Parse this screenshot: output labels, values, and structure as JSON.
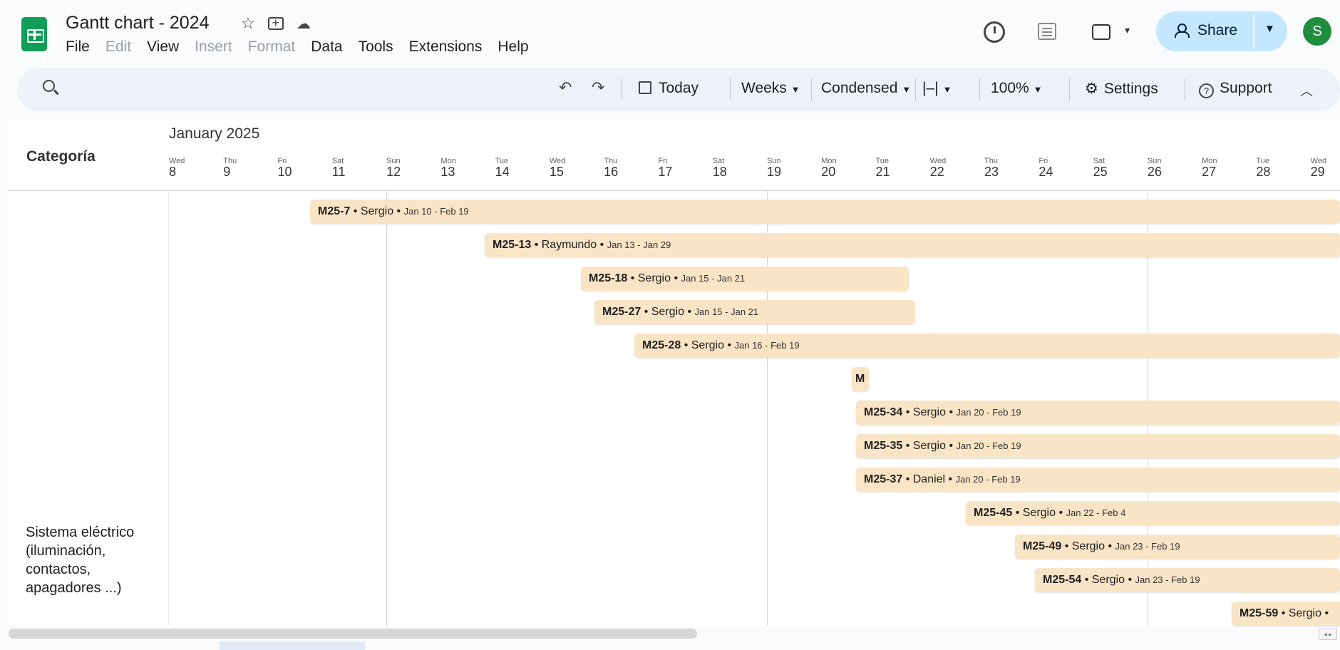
{
  "app": {
    "doc_title": "Gantt chart - 2024",
    "menu": [
      {
        "label": "File",
        "disabled": false
      },
      {
        "label": "Edit",
        "disabled": true
      },
      {
        "label": "View",
        "disabled": false
      },
      {
        "label": "Insert",
        "disabled": true
      },
      {
        "label": "Format",
        "disabled": true
      },
      {
        "label": "Data",
        "disabled": false
      },
      {
        "label": "Tools",
        "disabled": false
      },
      {
        "label": "Extensions",
        "disabled": false
      },
      {
        "label": "Help",
        "disabled": false
      }
    ],
    "share_label": "Share",
    "avatar_initial": "S",
    "accent_color": "#c2e7ff",
    "logo_color": "#0f9d58",
    "avatar_color": "#1e8e3e"
  },
  "toolbar": {
    "today": "Today",
    "weeks": "Weeks",
    "condensed": "Condensed",
    "zoom": "100%",
    "settings": "Settings",
    "support": "Support"
  },
  "timeline": {
    "category_header": "Categoría",
    "month": "January 2025",
    "days": [
      {
        "name": "Wed",
        "date": "8"
      },
      {
        "name": "Thu",
        "date": "9"
      },
      {
        "name": "Fri",
        "date": "10"
      },
      {
        "name": "Sat",
        "date": "11"
      },
      {
        "name": "Sun",
        "date": "12"
      },
      {
        "name": "Mon",
        "date": "13"
      },
      {
        "name": "Tue",
        "date": "14"
      },
      {
        "name": "Wed",
        "date": "15"
      },
      {
        "name": "Thu",
        "date": "16"
      },
      {
        "name": "Fri",
        "date": "17"
      },
      {
        "name": "Sat",
        "date": "18"
      },
      {
        "name": "Sun",
        "date": "19"
      },
      {
        "name": "Mon",
        "date": "20"
      },
      {
        "name": "Tue",
        "date": "21"
      },
      {
        "name": "Wed",
        "date": "22"
      },
      {
        "name": "Thu",
        "date": "23"
      },
      {
        "name": "Fri",
        "date": "24"
      },
      {
        "name": "Sat",
        "date": "25"
      },
      {
        "name": "Sun",
        "date": "26"
      },
      {
        "name": "Mon",
        "date": "27"
      },
      {
        "name": "Tue",
        "date": "28"
      },
      {
        "name": "Wed",
        "date": "29"
      }
    ],
    "category_label": "Sistema eléctrico (iluminación, contactos, apagadores ...)",
    "bar_color": "#fae4c6",
    "tasks": [
      {
        "id": "M25-7",
        "owner": "Sergio",
        "dates": "Jan 10 - Feb 19"
      },
      {
        "id": "M25-13",
        "owner": "Raymundo",
        "dates": "Jan 13 - Jan 29"
      },
      {
        "id": "M25-18",
        "owner": "Sergio",
        "dates": "Jan 15 - Jan 21"
      },
      {
        "id": "M25-27",
        "owner": "Sergio",
        "dates": "Jan 15 - Jan 21"
      },
      {
        "id": "M25-28",
        "owner": "Sergio",
        "dates": "Jan 16 - Feb 19"
      },
      {
        "id": "M",
        "owner": "",
        "dates": ""
      },
      {
        "id": "M25-34",
        "owner": "Sergio",
        "dates": "Jan 20 - Feb 19"
      },
      {
        "id": "M25-35",
        "owner": "Sergio",
        "dates": "Jan 20 - Feb 19"
      },
      {
        "id": "M25-37",
        "owner": "Daniel",
        "dates": "Jan 20 - Feb 19"
      },
      {
        "id": "M25-45",
        "owner": "Sergio",
        "dates": "Jan 22 - Feb 4"
      },
      {
        "id": "M25-49",
        "owner": "Sergio",
        "dates": "Jan 23 - Feb 19"
      },
      {
        "id": "M25-54",
        "owner": "Sergio",
        "dates": "Jan 23 - Feb 19"
      },
      {
        "id": "M25-59",
        "owner": "Sergio",
        "dates": ""
      }
    ]
  }
}
